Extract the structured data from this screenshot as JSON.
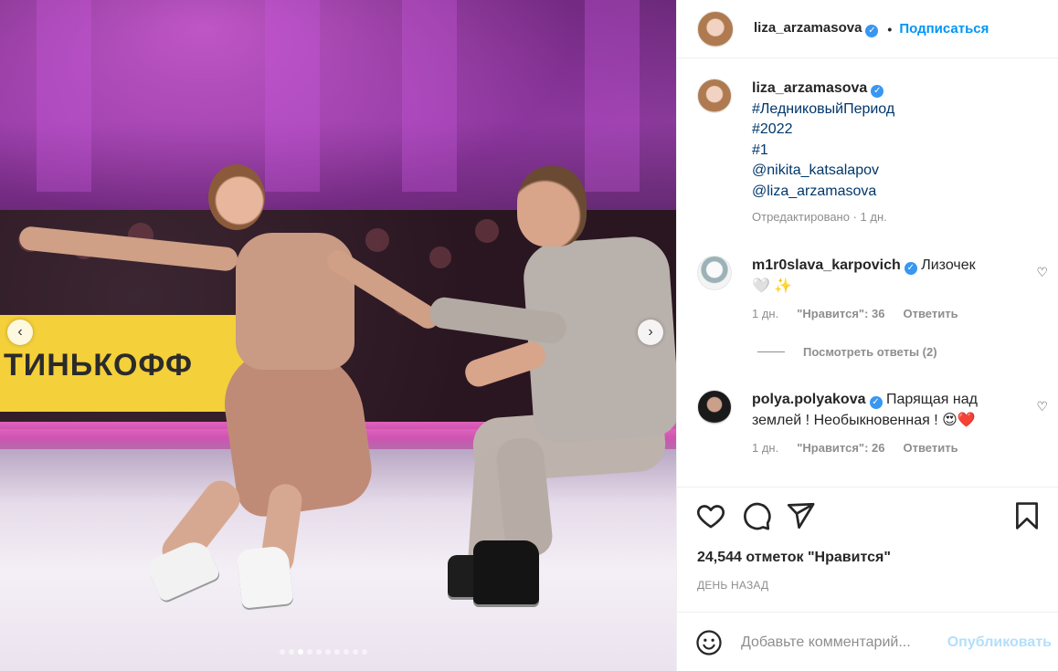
{
  "post": {
    "username": "liza_arzamasova",
    "verified_mark": "✓",
    "follow_label": "Подписаться",
    "separator": "•"
  },
  "media": {
    "banner_text": "ТИНЬКОФФ",
    "prev_glyph": "‹",
    "next_glyph": "›",
    "slide_count": 10,
    "active_slide": 3
  },
  "caption": {
    "username": "liza_arzamasova",
    "lines": [
      "#ЛедниковыйПериод",
      "#2022",
      "#1",
      "@nikita_katsalapov",
      "@liza_arzamasova"
    ],
    "edited": "Отредактировано · 1 дн."
  },
  "comments": [
    {
      "username": "m1r0slava_karpovich",
      "text": "Лизочек",
      "emoji": "🤍 ✨",
      "age": "1 дн.",
      "likes_label": "\"Нравится\": 36",
      "reply_label": "Ответить"
    },
    {
      "username": "polya.polyakova",
      "text": "Парящая над землей ! Необыкновенная ! 😍❤️",
      "age": "1 дн.",
      "likes_label": "\"Нравится\": 26",
      "reply_label": "Ответить"
    }
  ],
  "view_replies_label": "Посмотреть ответы (2)",
  "likes_text": "24,544 отметок \"Нравится\"",
  "posted_when": "ДЕНЬ НАЗАД",
  "comment_box": {
    "placeholder": "Добавьте комментарий...",
    "publish_label": "Опубликовать"
  },
  "colors": {
    "accent": "#0095f6",
    "publish_disabled": "#b2dffc",
    "muted": "#8e8e8e",
    "link": "#00376b",
    "verified": "#3897f0"
  },
  "icons": [
    "heart-icon",
    "comment-icon",
    "share-icon",
    "bookmark-icon",
    "emoji-icon",
    "verified-badge-icon"
  ]
}
